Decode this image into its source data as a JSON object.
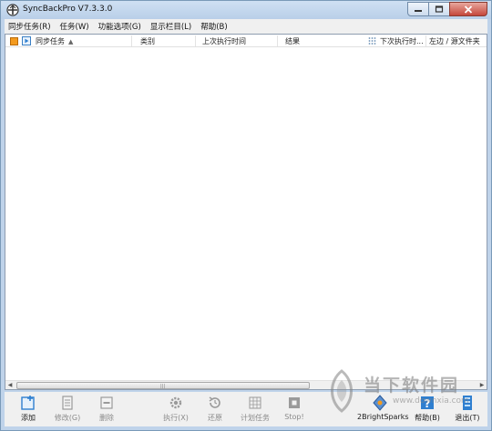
{
  "window": {
    "title": "SyncBackPro V7.3.3.0"
  },
  "menu": [
    "同步任务(R)",
    "任务(W)",
    "功能选项(G)",
    "显示栏目(L)",
    "帮助(B)"
  ],
  "columns": {
    "profile": "同步任务",
    "type": "类别",
    "last_run": "上次执行时间",
    "result": "结果",
    "next_run": "下次执行时...",
    "source": "左边 / 源文件夹"
  },
  "toolbar": {
    "add": "添加",
    "modify": "修改(G)",
    "delete": "删除",
    "run": "执行(X)",
    "restore": "还原",
    "schedule": "计划任务",
    "stop": "Stop!",
    "brand": "2BrightSparks",
    "help": "帮助(B)",
    "exit": "退出(T)"
  },
  "watermark": {
    "text": "当下软件园",
    "url": "www.downxia.com"
  },
  "colors": {
    "accent": "#2f7fd0",
    "titlebar": "#bfd3ea",
    "close": "#c5473b"
  }
}
